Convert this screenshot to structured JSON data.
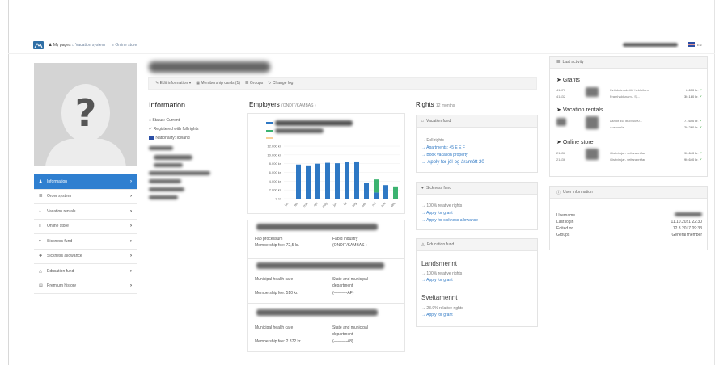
{
  "topbar": {
    "my_pages": "My pages",
    "vacation_system": "Vacation system",
    "online_store": "Online store",
    "language": "EN"
  },
  "tabs": {
    "edit_information": "Edit information",
    "membership_cards": "Membership cards (1)",
    "groups": "Groups",
    "change_log": "Change log"
  },
  "menu": [
    {
      "label": "Information",
      "icon": "user-icon",
      "active": true
    },
    {
      "label": "Order system",
      "icon": "list-icon",
      "active": false
    },
    {
      "label": "Vacation rentals",
      "icon": "home-icon",
      "active": false
    },
    {
      "label": "Online store",
      "icon": "cart-icon",
      "active": false
    },
    {
      "label": "Sickness fund",
      "icon": "heart-icon",
      "active": false
    },
    {
      "label": "Sickness allowance",
      "icon": "doctor-icon",
      "active": false
    },
    {
      "label": "Education fund",
      "icon": "graduation-icon",
      "active": false
    },
    {
      "label": "Premium history",
      "icon": "chart-icon",
      "active": false
    }
  ],
  "info": {
    "title": "Information",
    "status": "Status: Current",
    "registered": "Registered with full rights",
    "nationality": "Nationality: Iceland"
  },
  "employers": {
    "title": "Employers",
    "subtitle": "(ONDIT/KAMBAS )",
    "cards": [
      {
        "left_a": "Fab processum",
        "left_b": "Membership fee: 72,5 kr.",
        "right_a": "Fabid industry",
        "right_b": "(ONDIT/KAMBAS )"
      },
      {
        "left_a": "Municipal health care",
        "left_b": "Membership fee: 510 kr.",
        "right_a": "State and municipal",
        "right_b": "department",
        "right_c": "(———-AF)"
      },
      {
        "left_a": "Municipal health care",
        "left_b": "Membership fee: 2.872 kr.",
        "right_a": "State and municipal",
        "right_b": "department",
        "right_c": "(———-48)"
      }
    ]
  },
  "chart_data": {
    "type": "bar",
    "title": "",
    "ylim": [
      0,
      12000
    ],
    "yticks": [
      "0 kr.",
      "2.000 kr.",
      "4.000 kr.",
      "6.000 kr.",
      "8.000 kr.",
      "10.000 kr.",
      "12.000 kr."
    ],
    "categories": [
      "jan",
      "feb",
      "mar",
      "apr",
      "may",
      "jun",
      "jul",
      "aug",
      "sep",
      "oct",
      "nov",
      "dec"
    ],
    "series": [
      {
        "name": "",
        "values": [
          0,
          7800,
          7600,
          8000,
          8200,
          8100,
          8400,
          8500,
          3600,
          1400,
          3100,
          0
        ],
        "color": "#2e78c4"
      },
      {
        "name": "",
        "values": [
          0,
          0,
          0,
          0,
          0,
          0,
          0,
          0,
          0,
          3000,
          0,
          2800
        ],
        "color": "#3cb371"
      }
    ],
    "line_value": 9500,
    "line_color": "#f0a030",
    "legend": "top-left"
  },
  "rights": {
    "title": "Rights",
    "subtitle": "12 months",
    "vacation": {
      "head": "Vacation fund",
      "links": [
        "→ Full rights",
        "→ Apartments: 45 E E F",
        "→ Book vacation property",
        "→ Apply for jól-og áramótt 20"
      ]
    },
    "sickness": {
      "head": "Sickness fund",
      "links": [
        "→ 100% relative rights",
        "→ Apply for grant",
        "→ Apply for sickness allowance"
      ]
    },
    "education": {
      "head": "Education fund",
      "landsmennt": "Landsmennt",
      "landsmennt_links": [
        "→ 100% relative rights",
        "→ Apply for grant"
      ],
      "sveitamennt": "Sveitamennt",
      "sveitamennt_links": [
        "→ 23.9% relative rights",
        "→ Apply for grant"
      ]
    }
  },
  "activity": {
    "head": "Last activity",
    "grants_title": "Grants",
    "grants": [
      {
        "id": "41670",
        "desc": "Kvöldnámskeið í hekluðum",
        "amount": "6.670 kr."
      },
      {
        "id": "41432",
        "desc": "Framhaldsnám - Sj...",
        "amount": "30.180 kr."
      }
    ],
    "vacation_title": "Vacation rentals",
    "vacation": [
      {
        "id": "",
        "desc": "Ásholt 46, íbúð 4000...",
        "amount": "77.640 kr."
      },
      {
        "id": "",
        "desc": "Austurvör",
        "amount": "20.260 kr."
      }
    ],
    "store_title": "Online store",
    "store": [
      {
        "id": "21436",
        "desc": "Gistivirkjar- veitarabréfar",
        "amount": "90.640 kr."
      },
      {
        "id": "21436",
        "desc": "Gistivirkjar- veitarabréfar",
        "amount": "90.640 kr."
      }
    ]
  },
  "user_info": {
    "head": "User information",
    "rows": [
      {
        "key": "Username",
        "value": ""
      },
      {
        "key": "Last login",
        "value": "11.10.2021 22:30"
      },
      {
        "key": "Edited on",
        "value": "12.3.2017 09:33"
      },
      {
        "key": "Groups",
        "value": "General member"
      }
    ]
  }
}
